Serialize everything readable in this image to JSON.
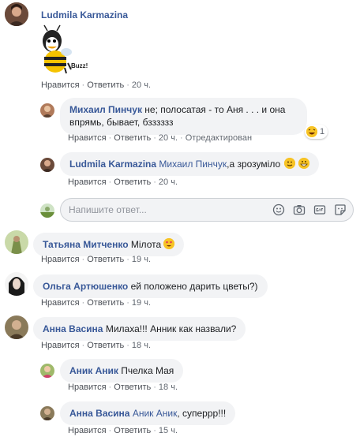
{
  "actions": {
    "like": "Нравится",
    "reply": "Ответить",
    "sep": "·"
  },
  "comments": [
    {
      "author": "Ludmila Karmazina",
      "time": "20 ч."
    },
    {
      "author": "Михаил Пинчук",
      "text": "не; полосатая - то Аня . . . и она впрямь, бывает, бзззззз",
      "time": "20 ч.",
      "edited": "Отредактирован",
      "reaction_count": "1"
    },
    {
      "author": "Ludmila Karmazina",
      "mention": "Михаил Пинчук",
      "text": ",а зрозуміло",
      "time": "20 ч."
    },
    {
      "author": "Татьяна Митченко",
      "text": "Мiлота",
      "time": "19 ч."
    },
    {
      "author": "Ольга Артюшенко",
      "text": "ей положено дарить цветы?)",
      "time": "19 ч."
    },
    {
      "author": "Анна Васина",
      "text": "Милаха!!! Анник как назвали?",
      "time": "18 ч."
    },
    {
      "author": "Аник Аник",
      "text": "Пчелка Мая",
      "time": "18 ч."
    },
    {
      "author": "Анна Васина",
      "mention": "Аник Аник",
      "text": ", суперрр!!!",
      "time": "15 ч."
    }
  ],
  "reply_input": {
    "placeholder": "Напишите ответ..."
  },
  "sticker_text": "Buzz!"
}
